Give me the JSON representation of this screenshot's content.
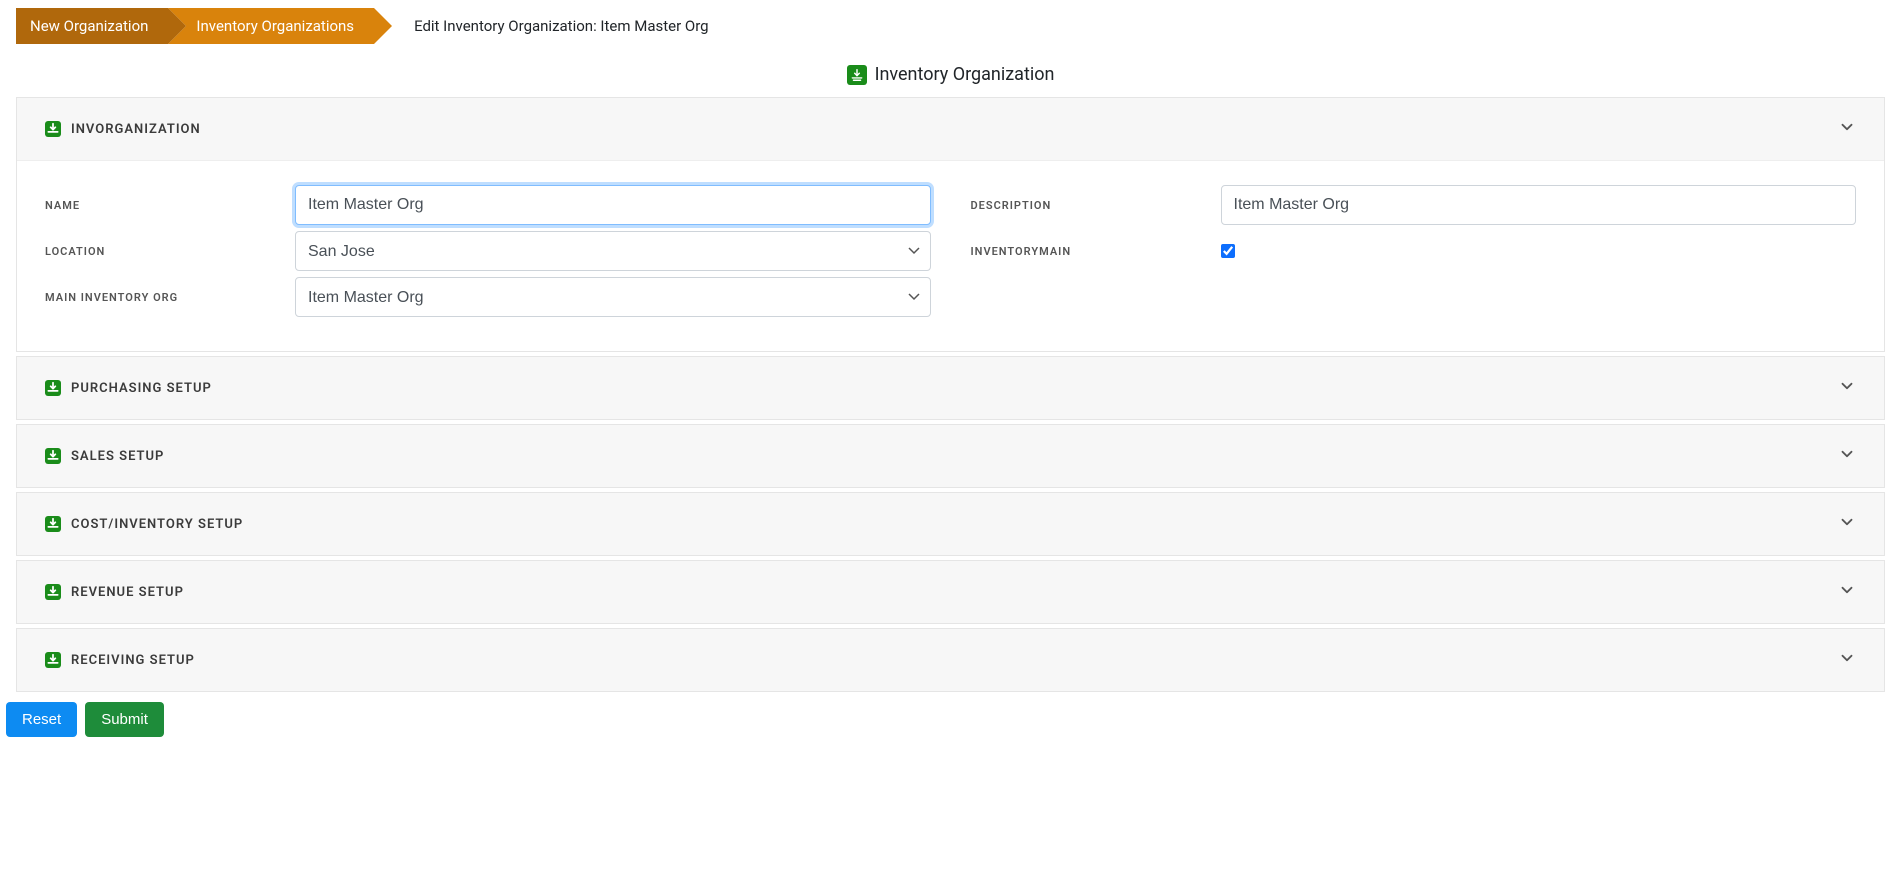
{
  "breadcrumb": {
    "item1": "New Organization",
    "item2": "Inventory Organizations",
    "current": "Edit Inventory Organization: Item Master Org"
  },
  "page": {
    "title": "Inventory Organization"
  },
  "panels": {
    "invorg": {
      "title": "INVORGANIZATION"
    },
    "purchasing": {
      "title": "PURCHASING SETUP"
    },
    "sales": {
      "title": "SALES SETUP"
    },
    "cost": {
      "title": "COST/INVENTORY SETUP"
    },
    "revenue": {
      "title": "REVENUE SETUP"
    },
    "receiving": {
      "title": "RECEIVING SETUP"
    }
  },
  "form": {
    "labels": {
      "name": "NAME",
      "location": "LOCATION",
      "mainInvOrg": "MAIN INVENTORY ORG",
      "description": "DESCRIPTION",
      "inventoryMain": "INVENTORYMAIN"
    },
    "values": {
      "name": "Item Master Org",
      "location": "San Jose",
      "mainInvOrg": "Item Master Org",
      "description": "Item Master Org",
      "inventoryMain": true
    }
  },
  "actions": {
    "reset": "Reset",
    "submit": "Submit"
  }
}
